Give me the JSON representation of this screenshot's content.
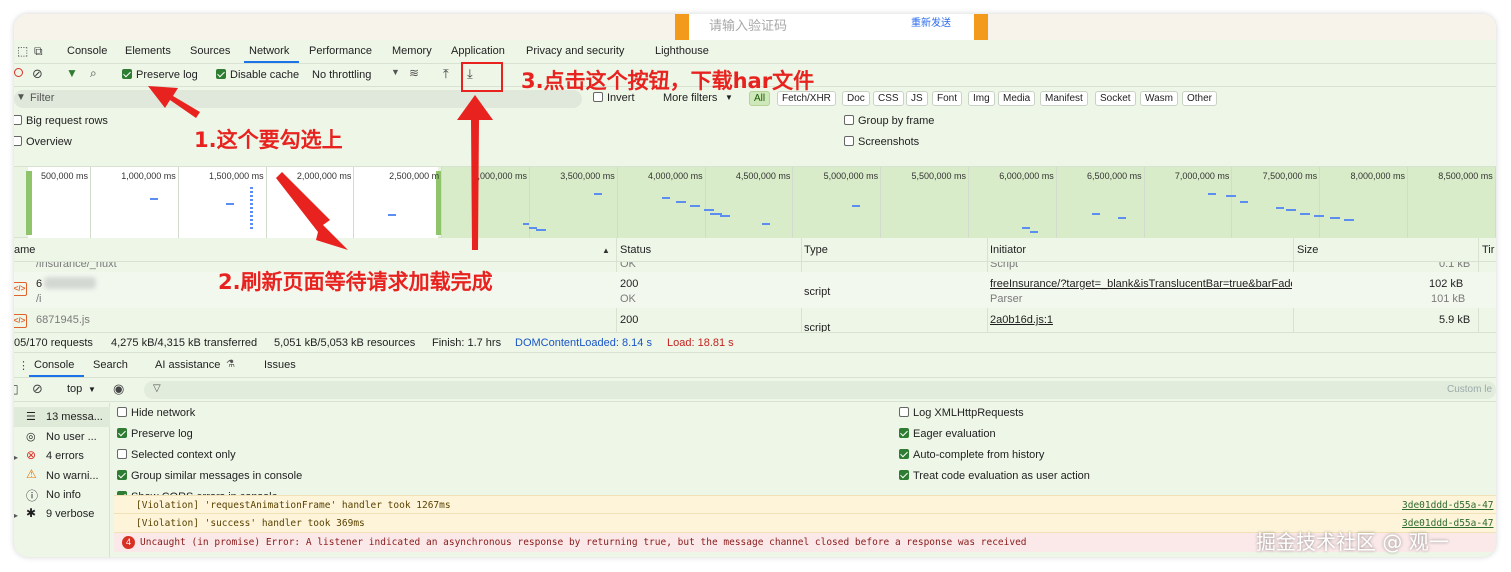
{
  "page": {
    "input_placeholder": "请输入验证码",
    "resend_link": "重新发送"
  },
  "tabs": [
    "Console",
    "Elements",
    "Sources",
    "Network",
    "Performance",
    "Memory",
    "Application",
    "Privacy and security",
    "Lighthouse"
  ],
  "active_tab": "Network",
  "toolbar": {
    "preserve_log": "Preserve log",
    "disable_cache": "Disable cache",
    "throttling": "No throttling"
  },
  "filter": {
    "placeholder": "Filter",
    "invert": "Invert",
    "more_filters": "More filters",
    "chips": [
      "All",
      "Fetch/XHR",
      "Doc",
      "CSS",
      "JS",
      "Font",
      "Img",
      "Media",
      "Manifest",
      "Socket",
      "Wasm",
      "Other"
    ]
  },
  "options": {
    "big_request_rows": "Big request rows",
    "overview": "Overview",
    "group_by_frame": "Group by frame",
    "screenshots": "Screenshots"
  },
  "overview_ticks": [
    "500,000 ms",
    "1,000,000 ms",
    "1,500,000 ms",
    "2,000,000 ms",
    "2,500,000 m",
    "3,000,000 ms",
    "3,500,000 ms",
    "4,000,000 ms",
    "4,500,000 ms",
    "5,000,000 ms",
    "5,500,000 ms",
    "6,000,000 ms",
    "6,500,000 ms",
    "7,000,000 ms",
    "7,500,000 ms",
    "8,000,000 ms",
    "8,500,000 ms"
  ],
  "table": {
    "columns": {
      "name": "ame",
      "status": "Status",
      "type": "Type",
      "initiator": "Initiator",
      "size": "Size",
      "time": "Tir"
    },
    "rows": [
      {
        "name": "/insurance/_nuxt",
        "status": "OK",
        "type": "",
        "initiator": "Script",
        "size": "0.1 kB"
      },
      {
        "name": "6",
        "sub": "/i",
        "status": "200",
        "status_text": "OK",
        "type": "script",
        "initiator": "freeInsurance/?target=_blank&isTranslucentBar=true&barFade",
        "initiator_sub": "Parser",
        "size": "102 kB",
        "size_sub": "101 kB"
      },
      {
        "name": "6871945.js",
        "status": "200",
        "type": "script",
        "initiator": "2a0b16d.js:1",
        "size": "5.9 kB"
      }
    ]
  },
  "status": {
    "requests": "05/170 requests",
    "transferred": "4,275 kB/4,315 kB transferred",
    "resources": "5,051 kB/5,053 kB resources",
    "finish": "Finish: 1.7 hrs",
    "dcl": "DOMContentLoaded: 8.14 s",
    "load": "Load: 18.81 s"
  },
  "drawer_tabs": [
    "Console",
    "Search",
    "AI assistance",
    "Issues"
  ],
  "console_toolbar": {
    "context": "top",
    "custom_levels": "Custom le"
  },
  "sidebar": [
    {
      "label": "13 messa...",
      "icon": "list-icon"
    },
    {
      "label": "No user ...",
      "icon": "user-icon"
    },
    {
      "label": "4 errors",
      "icon": "error-icon"
    },
    {
      "label": "No warni...",
      "icon": "warning-icon"
    },
    {
      "label": "No info",
      "icon": "info-icon"
    },
    {
      "label": "9 verbose",
      "icon": "bug-icon"
    }
  ],
  "settings_left": [
    {
      "label": "Hide network",
      "checked": false
    },
    {
      "label": "Preserve log",
      "checked": true
    },
    {
      "label": "Selected context only",
      "checked": false
    },
    {
      "label": "Group similar messages in console",
      "checked": true
    },
    {
      "label": "Show CORS errors in console",
      "checked": true
    }
  ],
  "settings_right": [
    {
      "label": "Log XMLHttpRequests",
      "checked": false
    },
    {
      "label": "Eager evaluation",
      "checked": true
    },
    {
      "label": "Auto-complete from history",
      "checked": true
    },
    {
      "label": "Treat code evaluation as user action",
      "checked": true
    }
  ],
  "logs": [
    {
      "level": "warn",
      "text": "[Violation] 'requestAnimationFrame' handler took 1267ms",
      "source": "3de01ddd-d55a-47"
    },
    {
      "level": "warn",
      "text": "[Violation] 'success' handler took 369ms",
      "source": "3de01ddd-d55a-47"
    },
    {
      "level": "error",
      "count": "4",
      "text": "Uncaught (in promise) Error: A listener indicated an asynchronous response by returning true, but the message channel closed before a response was received",
      "source": ""
    }
  ],
  "annotations": {
    "step1": "1.这个要勾选上",
    "step2": "2.刷新页面等待请求加载完成",
    "step3": "3.点击这个按钮，下载har文件"
  },
  "watermark": "掘金技术社区 @ 观一"
}
